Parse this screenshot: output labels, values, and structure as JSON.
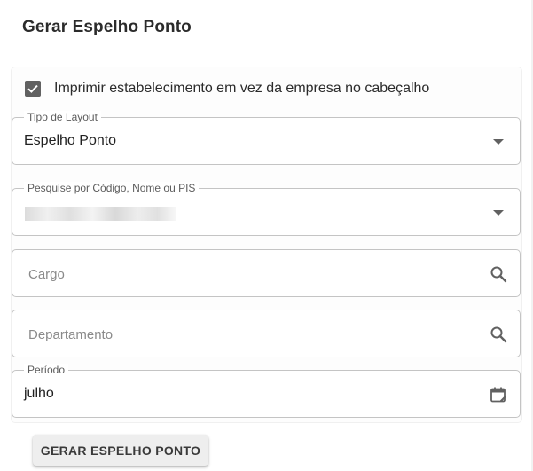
{
  "dialog": {
    "title": "Gerar Espelho Ponto"
  },
  "checkbox": {
    "label": "Imprimir estabelecimento em vez da empresa no cabeçalho",
    "checked": true
  },
  "fields": {
    "layout": {
      "label": "Tipo de Layout",
      "value": "Espelho Ponto",
      "icon": "arrow-drop-down-icon"
    },
    "employee": {
      "label": "Pesquise por Código, Nome ou PIS",
      "value": "",
      "icon": "arrow-drop-down-icon"
    },
    "cargo": {
      "placeholder": "Cargo",
      "icon": "search-icon"
    },
    "departamento": {
      "placeholder": "Departamento",
      "icon": "search-icon"
    },
    "periodo": {
      "label": "Período",
      "value": "julho",
      "icon": "calendar-edit-icon"
    }
  },
  "actions": {
    "generate_label": "GERAR ESPELHO PONTO"
  },
  "colors": {
    "checkbox": "#616161",
    "border": "#c4c4c4",
    "button_bg": "#eeeeee"
  }
}
